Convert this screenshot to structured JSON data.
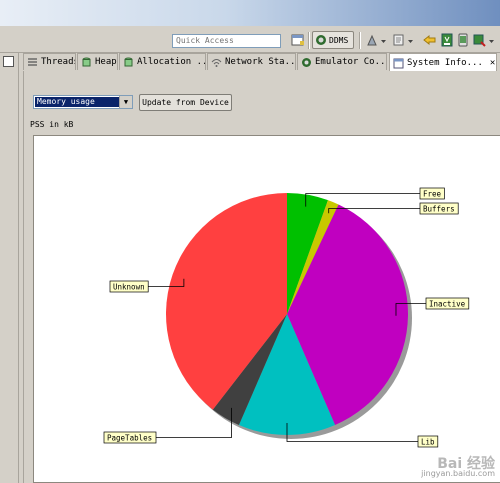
{
  "toolbar": {
    "quick_access_placeholder": "Quick Access",
    "ddms_label": "DDMS"
  },
  "tabs": [
    {
      "label": "Threads",
      "icon": "threads-icon"
    },
    {
      "label": "Heap",
      "icon": "heap-icon"
    },
    {
      "label": "Allocation ...",
      "icon": "allocation-icon"
    },
    {
      "label": "Network Sta...",
      "icon": "network-icon"
    },
    {
      "label": "Emulator Co...",
      "icon": "emulator-icon"
    },
    {
      "label": "System Info...",
      "icon": "system-info-icon",
      "active": true
    }
  ],
  "controls": {
    "dropdown_selected": "Memory usage",
    "update_button": "Update from Device",
    "pss_label": "PSS in kB"
  },
  "chart_data": {
    "type": "pie",
    "title": "",
    "labels": [
      "Free",
      "Buffers",
      "Inactive",
      "Lib",
      "PageTables",
      "Unknown"
    ],
    "values": [
      5.5,
      1.5,
      36.5,
      13.0,
      4.0,
      39.5
    ],
    "colors": [
      "#00c000",
      "#c8c800",
      "#c000c0",
      "#00c0c0",
      "#404040",
      "#ff4040"
    ]
  },
  "watermark": {
    "line1": "Bai 经验",
    "line2": "jingyan.baidu.com"
  }
}
